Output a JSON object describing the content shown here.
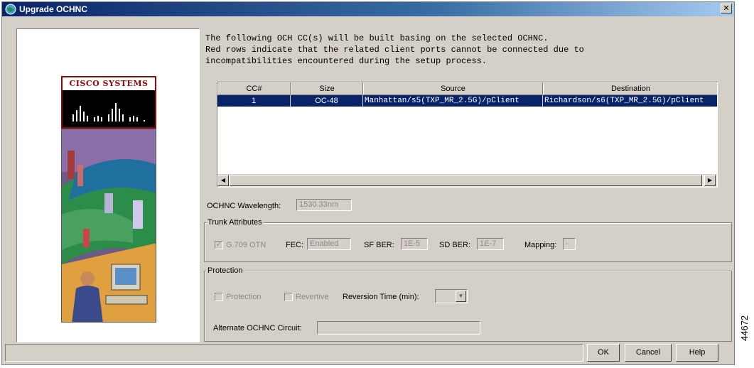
{
  "window": {
    "title": "Upgrade OCHNC",
    "close_glyph": "✕"
  },
  "intro": {
    "line1": "The following OCH CC(s) will be built basing on the selected OCHNC.",
    "line2": "Red rows indicate that the related client ports cannot be connected due to",
    "line3": "incompatibilities encountered during the setup process."
  },
  "logo": {
    "text": "CISCO SYSTEMS"
  },
  "table": {
    "columns": [
      "CC#",
      "Size",
      "Source",
      "Destination"
    ],
    "rows": [
      {
        "cc": "1",
        "size": "OC-48",
        "source": "Manhattan/s5(TXP_MR_2.5G)/pClient",
        "destination": "Richardson/s6(TXP_MR_2.5G)/pClient"
      }
    ],
    "selected_row_color": "#0a246a"
  },
  "wavelength": {
    "label": "OCHNC Wavelength:",
    "value": "1530.33nm"
  },
  "trunk": {
    "title": "Trunk Attributes",
    "g709_label": "G.709 OTN",
    "g709_checked": true,
    "fec_label": "FEC:",
    "fec_value": "Enabled",
    "sfber_label": "SF BER:",
    "sfber_value": "1E-5",
    "sdber_label": "SD BER:",
    "sdber_value": "1E-7",
    "mapping_label": "Mapping:",
    "mapping_value": "-"
  },
  "protection": {
    "title": "Protection",
    "protection_label": "Protection",
    "revertive_label": "Revertive",
    "reversion_label": "Reversion Time (min):",
    "alternate_label": "Alternate OCHNC Circuit:",
    "alternate_value": ""
  },
  "buttons": {
    "ok": "OK",
    "cancel": "Cancel",
    "help": "Help"
  },
  "figure_number": "44672",
  "icons": {
    "app": "app-globe-icon",
    "close": "close-icon",
    "scroll_left": "scroll-left-arrow-icon",
    "scroll_right": "scroll-right-arrow-icon",
    "combo_arrow": "chevron-down-icon"
  }
}
